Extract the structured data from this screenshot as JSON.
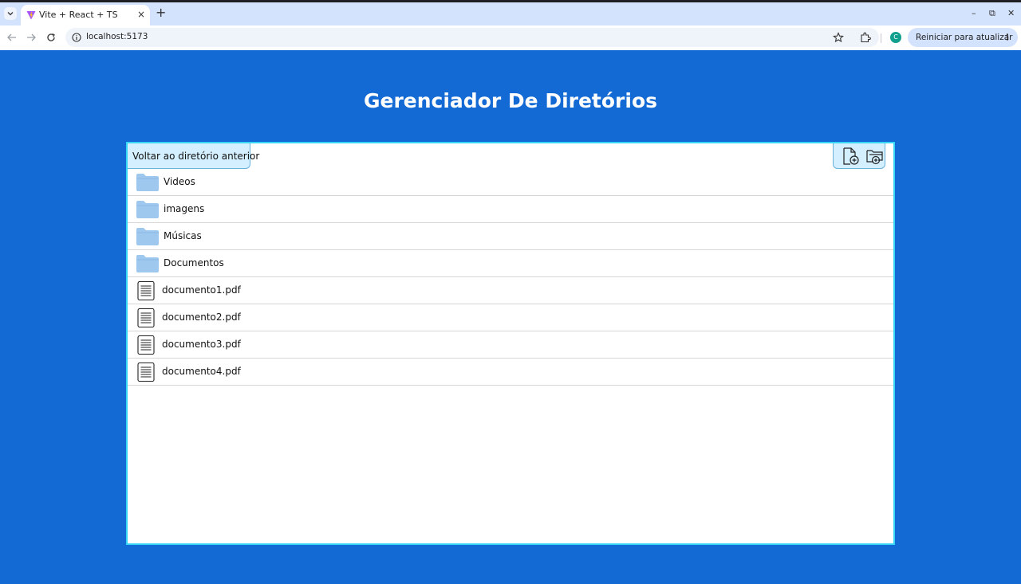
{
  "browser": {
    "tab_title": "Vite + React + TS",
    "tab_close": "×",
    "new_tab": "+",
    "url": "localhost:5173",
    "avatar_letter": "C",
    "update_button": "Reiniciar para atualizar",
    "update_menu": "⋮",
    "window_minimize": "–",
    "window_restore": "⧉",
    "window_close": "✕"
  },
  "page": {
    "title": "Gerenciador De Diretórios",
    "back_button": "Voltar ao diretório anterior"
  },
  "items": [
    {
      "type": "folder",
      "name": "Videos"
    },
    {
      "type": "folder",
      "name": "imagens"
    },
    {
      "type": "folder",
      "name": "Músicas"
    },
    {
      "type": "folder",
      "name": "Documentos"
    },
    {
      "type": "file",
      "name": "documento1.pdf"
    },
    {
      "type": "file",
      "name": "documento2.pdf"
    },
    {
      "type": "file",
      "name": "documento3.pdf"
    },
    {
      "type": "file",
      "name": "documento4.pdf"
    }
  ],
  "colors": {
    "background": "#136ad4",
    "panel_border": "#37d5f5",
    "button_bg": "#d4efff",
    "folder": "#9ec8ee"
  },
  "icons": {
    "folder": "folder-icon",
    "file": "file-icon",
    "new_file": "new-file-icon",
    "new_folder": "new-folder-icon"
  }
}
